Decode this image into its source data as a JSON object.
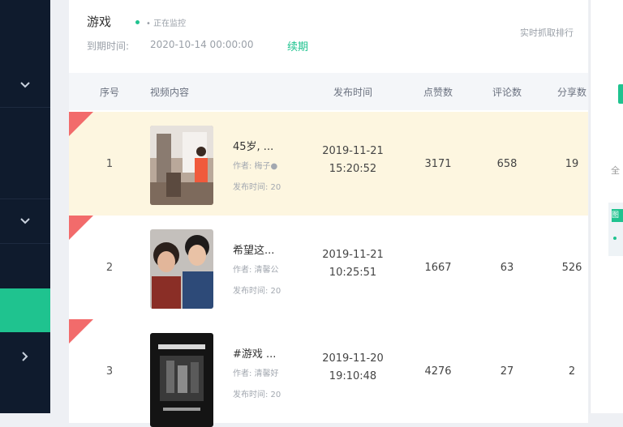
{
  "header": {
    "title": "游戏",
    "subtitle": "• 正在监控",
    "time_label": "到期时间:",
    "time_value": "2020-10-14 00:00:00",
    "renew_link": "续期",
    "realtime": "实时抓取排行"
  },
  "table": {
    "columns": [
      "序号",
      "视频内容",
      "发布时间",
      "点赞数",
      "评论数",
      "分享数"
    ],
    "rows": [
      {
        "rank": "1",
        "title": "45岁, ...",
        "author": "作者: 梅子●",
        "posted": "发布时间: 20",
        "pub_date": "2019-11-21",
        "pub_time": "15:20:52",
        "likes": "3171",
        "comments": "658",
        "shares": "19"
      },
      {
        "rank": "2",
        "title": "希望这...",
        "author": "作者: 清馨公",
        "posted": "发布时间: 20",
        "pub_date": "2019-11-21",
        "pub_time": "10:25:51",
        "likes": "1667",
        "comments": "63",
        "shares": "526"
      },
      {
        "rank": "3",
        "title": "#游戏 ...",
        "author": "作者: 清馨好",
        "posted": "发布时间: 20",
        "pub_date": "2019-11-20",
        "pub_time": "19:10:48",
        "likes": "4276",
        "comments": "27",
        "shares": "2"
      }
    ]
  },
  "right_panel": {
    "text": "全",
    "tag": "图"
  },
  "colors": {
    "accent": "#1fc38f",
    "sidebar": "#0f1b2d",
    "highlight_row": "#fdf6e0",
    "badge": "#f26b6b"
  }
}
